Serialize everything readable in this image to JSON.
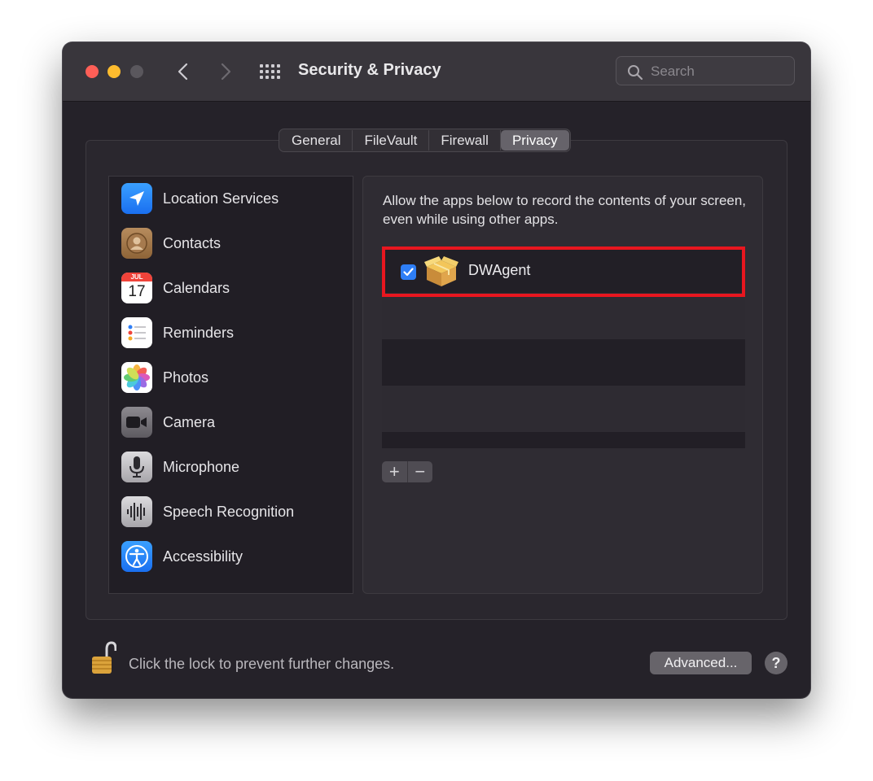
{
  "window": {
    "title": "Security & Privacy",
    "search_placeholder": "Search"
  },
  "tabs": [
    {
      "label": "General",
      "active": false
    },
    {
      "label": "FileVault",
      "active": false
    },
    {
      "label": "Firewall",
      "active": false
    },
    {
      "label": "Privacy",
      "active": true
    }
  ],
  "sidebar": {
    "items": [
      {
        "label": "Location Services",
        "icon": "location-arrow-icon"
      },
      {
        "label": "Contacts",
        "icon": "contacts-icon"
      },
      {
        "label": "Calendars",
        "icon": "calendar-icon",
        "icon_month": "JUL",
        "icon_day": "17"
      },
      {
        "label": "Reminders",
        "icon": "reminders-icon"
      },
      {
        "label": "Photos",
        "icon": "photos-icon"
      },
      {
        "label": "Camera",
        "icon": "camera-icon"
      },
      {
        "label": "Microphone",
        "icon": "microphone-icon"
      },
      {
        "label": "Speech Recognition",
        "icon": "speech-waveform-icon"
      },
      {
        "label": "Accessibility",
        "icon": "accessibility-icon"
      }
    ]
  },
  "panel": {
    "description": "Allow the apps below to record the contents of your screen, even while using other apps.",
    "apps": [
      {
        "name": "DWAgent",
        "checked": true,
        "icon": "package-box-icon"
      }
    ],
    "add_label": "+",
    "remove_label": "−"
  },
  "footer": {
    "lock_text": "Click the lock to prevent further changes.",
    "advanced_label": "Advanced...",
    "help_label": "?"
  },
  "colors": {
    "accent": "#2e7ef6",
    "highlight_border": "#e8161f",
    "window_bg": "#252229"
  }
}
